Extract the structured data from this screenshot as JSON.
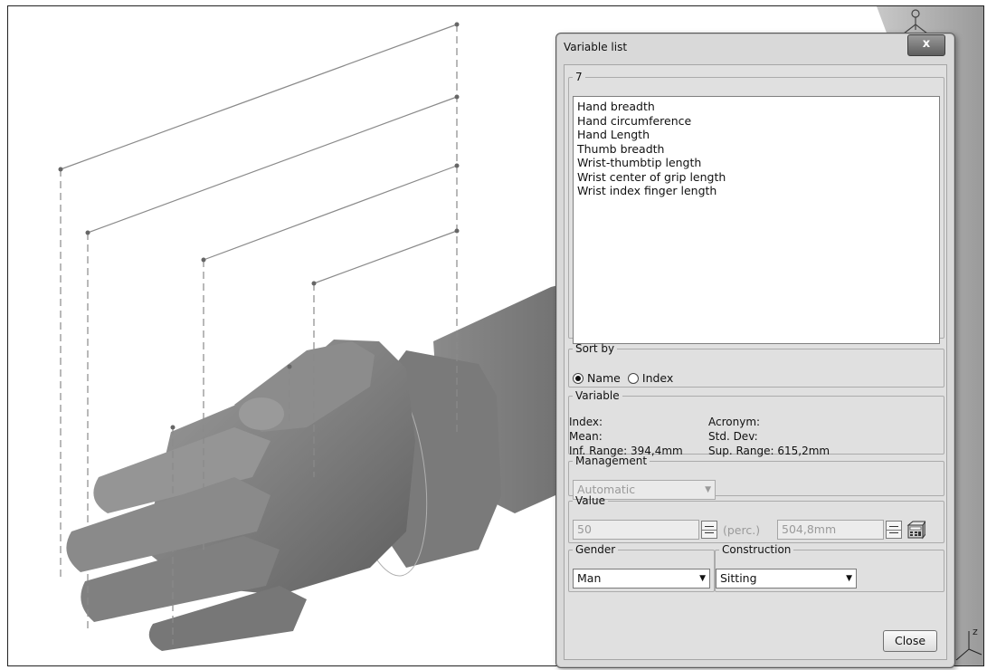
{
  "dialog": {
    "title": "Variable list",
    "close_glyph": "x",
    "list_group_label": "7",
    "variables": [
      "Hand breadth",
      "Hand circumference",
      "Hand Length",
      "Thumb breadth",
      "Wrist-thumbtip length",
      "Wrist center of grip length",
      "Wrist index finger length"
    ],
    "sort": {
      "label": "Sort by",
      "name_option": "Name",
      "index_option": "Index",
      "selected": "Name"
    },
    "variable": {
      "label": "Variable",
      "index_label": "Index:",
      "acronym_label": "Acronym:",
      "mean_label": "Mean:",
      "std_label": "Std. Dev:",
      "inf_range": "Inf. Range: 394,4mm",
      "sup_range": "Sup. Range: 615,2mm"
    },
    "management": {
      "label": "Management",
      "value": "Automatic"
    },
    "value": {
      "label": "Value",
      "percent": "50",
      "unit_label": "(perc.)",
      "measure": "504,8mm"
    },
    "gender": {
      "label": "Gender",
      "value": "Man"
    },
    "construction": {
      "label": "Construction",
      "value": "Sitting"
    },
    "close_button": "Close"
  },
  "viewport": {
    "axis_label": "z"
  },
  "icons": [
    "close-icon",
    "dropdown-arrow-icon",
    "calculator-icon",
    "compass-icon",
    "axis-triad-icon"
  ]
}
